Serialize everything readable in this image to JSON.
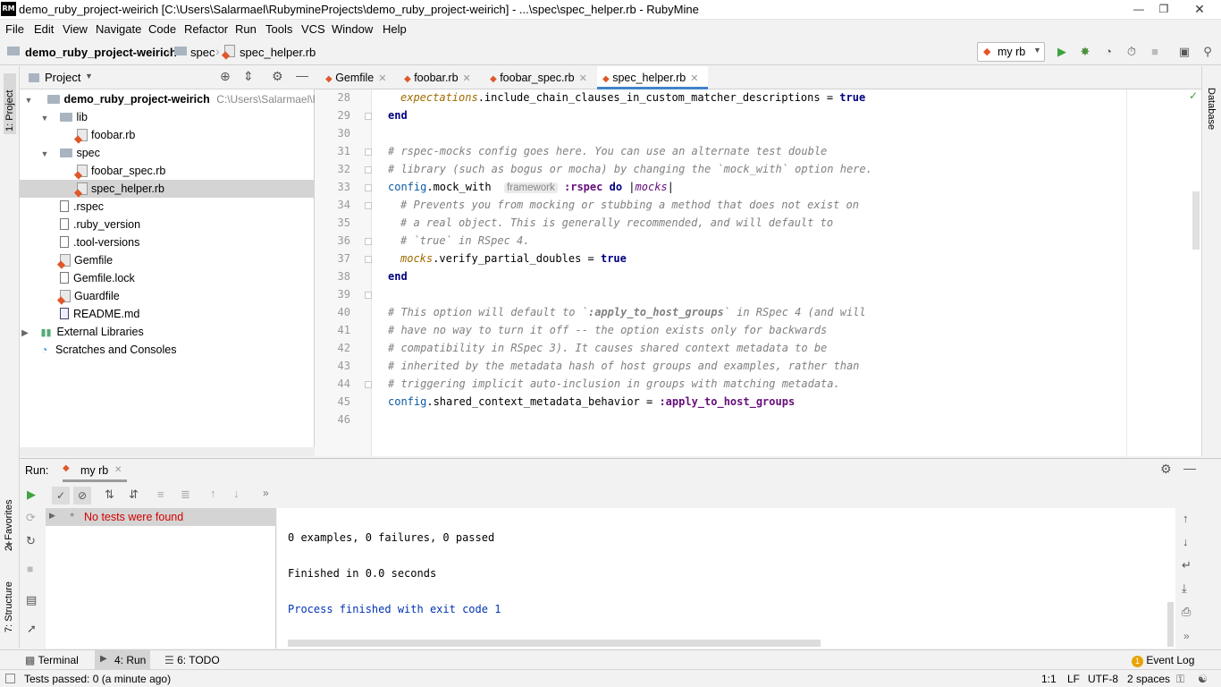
{
  "window": {
    "app_icon": "RM",
    "title": "demo_ruby_project-weirich [C:\\Users\\Salarmael\\RubymineProjects\\demo_ruby_project-weirich] - ...\\spec\\spec_helper.rb - RubyMine"
  },
  "menu": [
    "File",
    "Edit",
    "View",
    "Navigate",
    "Code",
    "Refactor",
    "Run",
    "Tools",
    "VCS",
    "Window",
    "Help"
  ],
  "breadcrumb": [
    "demo_ruby_project-weirich",
    "spec",
    "spec_helper.rb"
  ],
  "toolbar": {
    "run_config": "my rb"
  },
  "left_stripe": {
    "project_tab": "1: Project",
    "favorites_tab": "2: Favorites",
    "structure_tab": "7: Structure"
  },
  "right_stripe": {
    "database_tab": "Database"
  },
  "project": {
    "header": "Project",
    "tree": [
      {
        "label": "demo_ruby_project-weirich",
        "path": "C:\\Users\\Salarmael\\Ruby"
      },
      {
        "label": "lib"
      },
      {
        "label": "foobar.rb"
      },
      {
        "label": "spec"
      },
      {
        "label": "foobar_spec.rb"
      },
      {
        "label": "spec_helper.rb"
      },
      {
        "label": ".rspec"
      },
      {
        "label": ".ruby_version"
      },
      {
        "label": ".tool-versions"
      },
      {
        "label": "Gemfile"
      },
      {
        "label": "Gemfile.lock"
      },
      {
        "label": "Guardfile"
      },
      {
        "label": "README.md"
      },
      {
        "label": "External Libraries"
      },
      {
        "label": "Scratches and Consoles"
      }
    ]
  },
  "editor": {
    "tabs": [
      "Gemfile",
      "foobar.rb",
      "foobar_spec.rb",
      "spec_helper.rb"
    ],
    "active_tab": "spec_helper.rb",
    "line_numbers": [
      "28",
      "29",
      "30",
      "31",
      "32",
      "33",
      "34",
      "35",
      "36",
      "37",
      "38",
      "39",
      "40",
      "41",
      "42",
      "43",
      "44",
      "45",
      "46"
    ],
    "code": {
      "l28_a": "expectations",
      "l28_b": ".include_chain_clauses_in_custom_matcher_descriptions = ",
      "l28_c": "true",
      "l29": "end",
      "l31": "# rspec-mocks config goes here. You can use an alternate test double",
      "l32": "# library (such as bogus or mocha) by changing the `mock_with` option here.",
      "l33_a": "config",
      "l33_b": ".mock_with ",
      "l33_hint": "framework",
      "l33_c": ":rspec",
      "l33_d": "do",
      "l33_e": "|",
      "l33_f": "mocks",
      "l33_g": "|",
      "l34": "# Prevents you from mocking or stubbing a method that does not exist on",
      "l35": "# a real object. This is generally recommended, and will default to",
      "l36": "# `true` in RSpec 4.",
      "l37_a": "mocks",
      "l37_b": ".verify_partial_doubles = ",
      "l37_c": "true",
      "l38": "end",
      "l40_a": "# This option will default to `",
      "l40_b": ":apply_to_host_groups",
      "l40_c": "` in RSpec 4 (and will",
      "l41": "# have no way to turn it off -- the option exists only for backwards",
      "l42": "# compatibility in RSpec 3). It causes shared context metadata to be",
      "l43": "# inherited by the metadata hash of host groups and examples, rather than",
      "l44": "# triggering implicit auto-inclusion in groups with matching metadata.",
      "l45_a": "config",
      "l45_b": ".shared_context_metadata_behavior = ",
      "l45_c": ":apply_to_host_groups"
    }
  },
  "run": {
    "label": "Run:",
    "tab": "my rb",
    "tree_item": "No tests were found",
    "console": [
      "0 examples, 0 failures, 0 passed",
      "Finished in 0.0 seconds",
      "Process finished with exit code 1"
    ]
  },
  "bottom_tabs": {
    "terminal": "Terminal",
    "run": "4: Run",
    "todo": "6: TODO",
    "event_log": "Event Log",
    "event_count": "1"
  },
  "status": {
    "message": "Tests passed: 0 (a minute ago)",
    "position": "1:1",
    "line_sep": "LF",
    "encoding": "UTF-8",
    "indent": "2 spaces"
  },
  "colors": {
    "accent": "#4083c9",
    "error_text": "#d40000",
    "console_blue": "#0033b3",
    "run_green": "#3da33d"
  }
}
